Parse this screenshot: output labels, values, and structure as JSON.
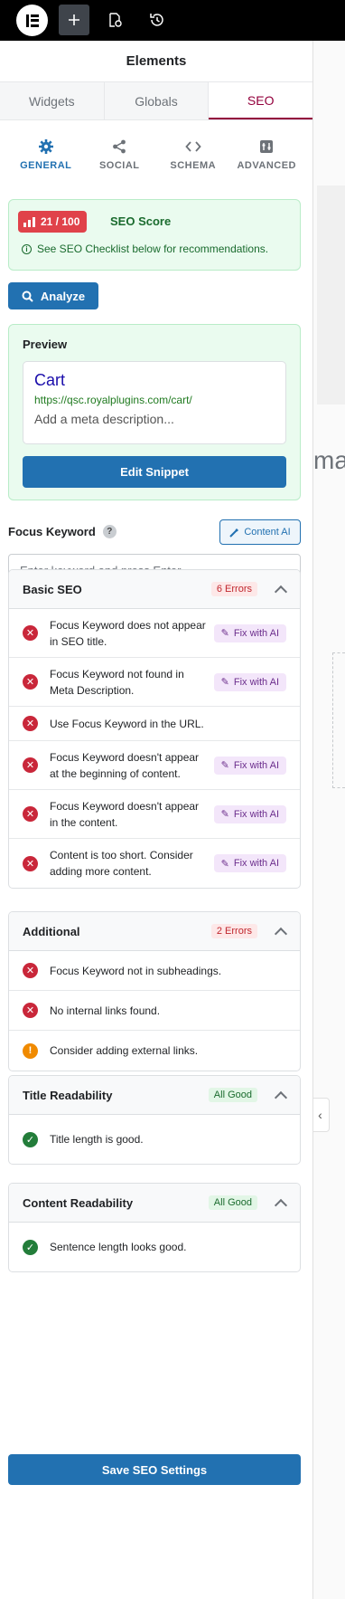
{
  "topbar": {
    "logo_icon": "elementor-logo-icon",
    "add_icon": "plus-icon",
    "page_settings_icon": "page-settings-icon",
    "history_icon": "history-icon"
  },
  "panel": {
    "title": "Elements",
    "tabs": [
      {
        "label": "Widgets",
        "active": false
      },
      {
        "label": "Globals",
        "active": false
      },
      {
        "label": "SEO",
        "active": true
      }
    ],
    "subtabs": [
      {
        "label": "GENERAL",
        "icon": "gear-icon",
        "active": true
      },
      {
        "label": "SOCIAL",
        "icon": "share-icon",
        "active": false
      },
      {
        "label": "SCHEMA",
        "icon": "code-icon",
        "active": false
      },
      {
        "label": "ADVANCED",
        "icon": "advanced-settings-icon",
        "active": false
      }
    ]
  },
  "score": {
    "value": "21 / 100",
    "label": "SEO Score",
    "note": "See SEO Checklist below for recommendations.",
    "color": "#e0424a"
  },
  "analyze_label": "Analyze",
  "preview": {
    "heading": "Preview",
    "title": "Cart",
    "url": "https://qsc.royalplugins.com/cart/",
    "description": "Add a meta description...",
    "edit_label": "Edit Snippet"
  },
  "focus_keyword": {
    "label": "Focus Keyword",
    "help": "?",
    "content_ai_label": "Content AI",
    "placeholder": "Enter keyword and press Enter"
  },
  "sections": {
    "basic": {
      "title": "Basic SEO",
      "badge": "6 Errors",
      "items": [
        {
          "text": "Focus Keyword does not appear in SEO title.",
          "status": "error",
          "action": "Fix with AI"
        },
        {
          "text": "Focus Keyword not found in Meta Description.",
          "status": "error",
          "action": "Fix with AI"
        },
        {
          "text": "Use Focus Keyword in the URL.",
          "status": "error",
          "action": ""
        },
        {
          "text": "Focus Keyword doesn't appear at the beginning of content.",
          "status": "error",
          "action": "Fix with AI"
        },
        {
          "text": "Focus Keyword doesn't appear in the content.",
          "status": "error",
          "action": "Fix with AI"
        },
        {
          "text": "Content is too short. Consider adding more content.",
          "status": "error",
          "action": "Fix with AI"
        }
      ]
    },
    "additional": {
      "title": "Additional",
      "badge": "2 Errors",
      "items": [
        {
          "text": "Focus Keyword not in subheadings.",
          "status": "error"
        },
        {
          "text": "No internal links found.",
          "status": "error"
        },
        {
          "text": "Consider adding external links.",
          "status": "warning"
        }
      ]
    },
    "title_readability": {
      "title": "Title Readability",
      "badge": "All Good",
      "items": [
        {
          "text": "Title length is good.",
          "status": "ok"
        }
      ]
    },
    "content_readability": {
      "title": "Content Readability",
      "badge": "All Good",
      "items": [
        {
          "text": "Sentence length looks good.",
          "status": "ok"
        }
      ]
    }
  },
  "save_label": "Save SEO Settings",
  "canvas": {
    "visible_text": "ma"
  },
  "colors": {
    "primary": "#2271b1",
    "accent_tab": "#93003c",
    "error": "#c9273a",
    "warning": "#f08a00",
    "success": "#237d3a"
  }
}
